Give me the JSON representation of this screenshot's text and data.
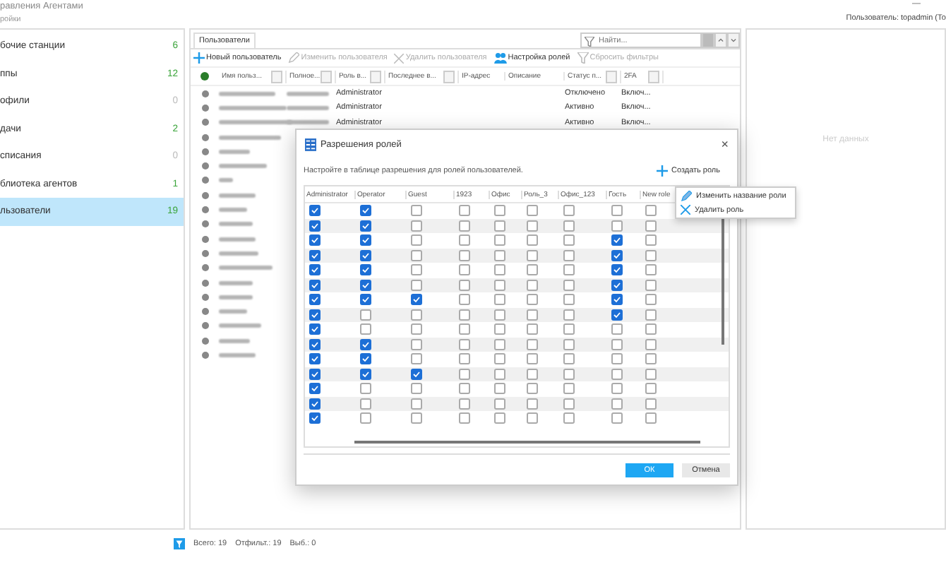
{
  "window": {
    "title": "равления Агентами",
    "subtitle": "ройки",
    "user": "Пользователь: topadmin (То",
    "minimize": "—"
  },
  "sidebar": {
    "items": [
      {
        "label": "бочие станции",
        "count": "6",
        "color": "#3aa43a",
        "selected": false
      },
      {
        "label": "ппы",
        "count": "12",
        "color": "#3aa43a",
        "selected": false
      },
      {
        "label": "офили",
        "count": "0",
        "color": "#bbbbbb",
        "selected": false
      },
      {
        "label": "дачи",
        "count": "2",
        "color": "#3aa43a",
        "selected": false
      },
      {
        "label": "списания",
        "count": "0",
        "color": "#bbbbbb",
        "selected": false
      },
      {
        "label": "блиотека агентов",
        "count": "1",
        "color": "#3aa43a",
        "selected": false
      },
      {
        "label": "льзователи",
        "count": "19",
        "color": "#3aa43a",
        "selected": true
      }
    ]
  },
  "users_panel": {
    "tab": "Пользователи",
    "search": {
      "placeholder": "Найти..."
    },
    "toolbar": [
      {
        "label": "Новый пользователь",
        "disabled": false
      },
      {
        "label": "Изменить пользователя",
        "disabled": true
      },
      {
        "label": "Удалить пользователя",
        "disabled": true
      },
      {
        "label": "Настройка ролей",
        "disabled": false
      },
      {
        "label": "Сбросить фильтры",
        "disabled": true
      }
    ],
    "columns": [
      {
        "label": "Имя польз...",
        "filter": true
      },
      {
        "label": "Полное...",
        "filter": true
      },
      {
        "label": "Роль в...",
        "filter": true
      },
      {
        "label": "Последнее в...",
        "filter": true
      },
      {
        "label": "IP-адрес",
        "filter": false
      },
      {
        "label": "Описание",
        "filter": false
      },
      {
        "label": "Статус п...",
        "filter": true
      },
      {
        "label": "2FA",
        "filter": true
      }
    ],
    "rows": [
      {
        "role": "Administrator",
        "status": "Отключено",
        "twofa": "Включ..."
      },
      {
        "role": "Administrator",
        "status": "Активно",
        "twofa": "Включ..."
      },
      {
        "role": "Administrator",
        "status": "Активно",
        "twofa": "Включ..."
      },
      {},
      {},
      {},
      {},
      {},
      {},
      {},
      {},
      {},
      {},
      {},
      {},
      {},
      {},
      {},
      {}
    ]
  },
  "details_panel": {
    "empty_text": "Нет данных"
  },
  "status_bar": {
    "total": "Всего: 19",
    "filtered": "Отфильт.: 19",
    "selected": "Выб.: 0"
  },
  "dialog": {
    "title": "Разрешения ролей",
    "close": "×",
    "instruction": "Настройте в таблице разрешения для ролей пользователей.",
    "create_role": "Создать роль",
    "roles": [
      "Administrator",
      "Operator",
      "Guest",
      "1923",
      "Офис",
      "Роль_3",
      "Офис_123",
      "Гость",
      "New role"
    ],
    "permissions": [
      [
        true,
        true,
        false,
        false,
        false,
        false,
        false,
        false,
        false
      ],
      [
        true,
        true,
        false,
        false,
        false,
        false,
        false,
        false,
        false
      ],
      [
        true,
        true,
        false,
        false,
        false,
        false,
        false,
        true,
        false
      ],
      [
        true,
        true,
        false,
        false,
        false,
        false,
        false,
        true,
        false
      ],
      [
        true,
        true,
        false,
        false,
        false,
        false,
        false,
        true,
        false
      ],
      [
        true,
        true,
        false,
        false,
        false,
        false,
        false,
        true,
        false
      ],
      [
        true,
        true,
        true,
        false,
        false,
        false,
        false,
        true,
        false
      ],
      [
        true,
        false,
        false,
        false,
        false,
        false,
        false,
        true,
        false
      ],
      [
        true,
        false,
        false,
        false,
        false,
        false,
        false,
        false,
        false
      ],
      [
        true,
        true,
        false,
        false,
        false,
        false,
        false,
        false,
        false
      ],
      [
        true,
        true,
        false,
        false,
        false,
        false,
        false,
        false,
        false
      ],
      [
        true,
        true,
        true,
        false,
        false,
        false,
        false,
        false,
        false
      ],
      [
        true,
        false,
        false,
        false,
        false,
        false,
        false,
        false,
        false
      ],
      [
        true,
        false,
        false,
        false,
        false,
        false,
        false,
        false,
        false
      ],
      [
        true,
        false,
        false,
        false,
        false,
        false,
        false,
        false,
        false
      ]
    ],
    "buttons": [
      {
        "label": "ОК",
        "primary": true
      },
      {
        "label": "Отмена",
        "primary": false
      }
    ],
    "context_menu": [
      "Изменить название роли",
      "Удалить роль"
    ]
  }
}
